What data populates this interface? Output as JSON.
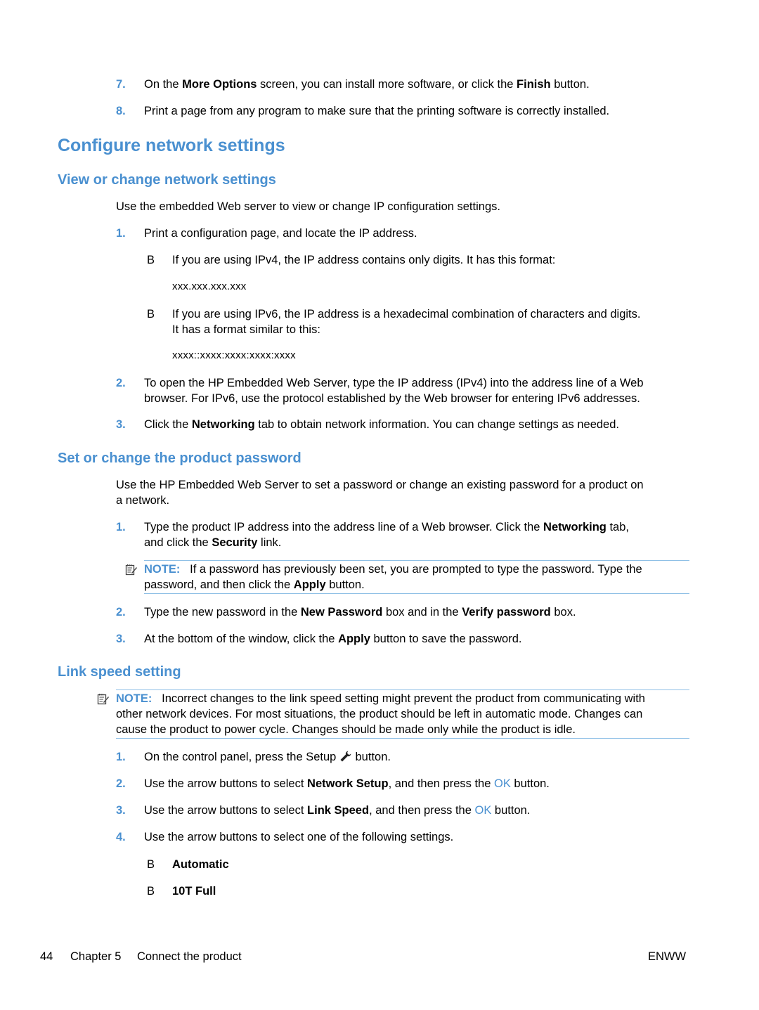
{
  "top_steps": [
    {
      "num": "7.",
      "pre": "On the ",
      "b1": "More Options",
      "mid": " screen, you can install more software, or click the ",
      "b2": "Finish",
      "post": " button."
    },
    {
      "num": "8.",
      "text": "Print a page from any program to make sure that the printing software is correctly installed."
    }
  ],
  "section_title": "Configure network settings",
  "view": {
    "title": "View or change network settings",
    "intro": "Use the embedded Web server to view or change IP configuration settings.",
    "step1": {
      "num": "1.",
      "text": "Print a configuration page, and locate the IP address."
    },
    "bullet_glyph": "B",
    "ipv4_text": "If you are using IPv4, the IP address contains only digits. It has this format:",
    "ipv4_format": "xxx.xxx.xxx.xxx",
    "ipv6_text_1": "If you are using IPv6, the IP address is a hexadecimal combination of characters and digits.",
    "ipv6_text_2": "It has a format similar to this:",
    "ipv6_format": "xxxx::xxxx:xxxx:xxxx:xxxx",
    "step2": {
      "num": "2.",
      "line1": "To open the HP Embedded Web Server, type the IP address (IPv4) into the address line of a Web",
      "line2": "browser. For IPv6, use the protocol established by the Web browser for entering IPv6 addresses."
    },
    "step3": {
      "num": "3.",
      "pre": "Click the ",
      "bold": "Networking",
      "post": " tab to obtain network information. You can change settings as needed."
    }
  },
  "password": {
    "title": "Set or change the product password",
    "intro_1": "Use the HP Embedded Web Server to set a password or change an existing password for a product on",
    "intro_2": "a network.",
    "step1": {
      "num": "1.",
      "pre": "Type the product IP address into the address line of a Web browser. Click the ",
      "b1": "Networking",
      "mid": " tab,",
      "line2_pre": "and click the ",
      "b2": "Security",
      "line2_post": " link."
    },
    "note": {
      "label": "NOTE:",
      "line1": "If a password has previously been set, you are prompted to type the password. Type the",
      "line2_pre": "password, and then click the ",
      "bold": "Apply",
      "line2_post": " button."
    },
    "step2": {
      "num": "2.",
      "pre": "Type the new password in the ",
      "b1": "New Password",
      "mid": " box and in the ",
      "b2": "Verify password",
      "post": " box."
    },
    "step3": {
      "num": "3.",
      "pre": "At the bottom of the window, click the ",
      "bold": "Apply",
      "post": " button to save the password."
    }
  },
  "link": {
    "title": "Link speed setting",
    "note": {
      "label": "NOTE:",
      "line1": "Incorrect changes to the link speed setting might prevent the product from communicating with",
      "line2": "other network devices. For most situations, the product should be left in automatic mode. Changes can",
      "line3": "cause the product to power cycle. Changes should be made only while the product is idle."
    },
    "step1": {
      "num": "1.",
      "pre": "On the control panel, press the Setup ",
      "post": " button."
    },
    "step2": {
      "num": "2.",
      "pre": "Use the arrow buttons to select ",
      "bold": "Network Setup",
      "mid": ", and then press the ",
      "ok": "OK",
      "post": " button."
    },
    "step3": {
      "num": "3.",
      "pre": "Use the arrow buttons to select ",
      "bold": "Link Speed",
      "mid": ", and then press the ",
      "ok": "OK",
      "post": " button."
    },
    "step4": {
      "num": "4.",
      "text": "Use the arrow buttons to select one of the following settings."
    },
    "options": [
      "Automatic",
      "10T Full"
    ]
  },
  "footer": {
    "page_number": "44",
    "chapter": "Chapter 5",
    "chapter_title": "Connect the product",
    "right": "ENWW"
  }
}
